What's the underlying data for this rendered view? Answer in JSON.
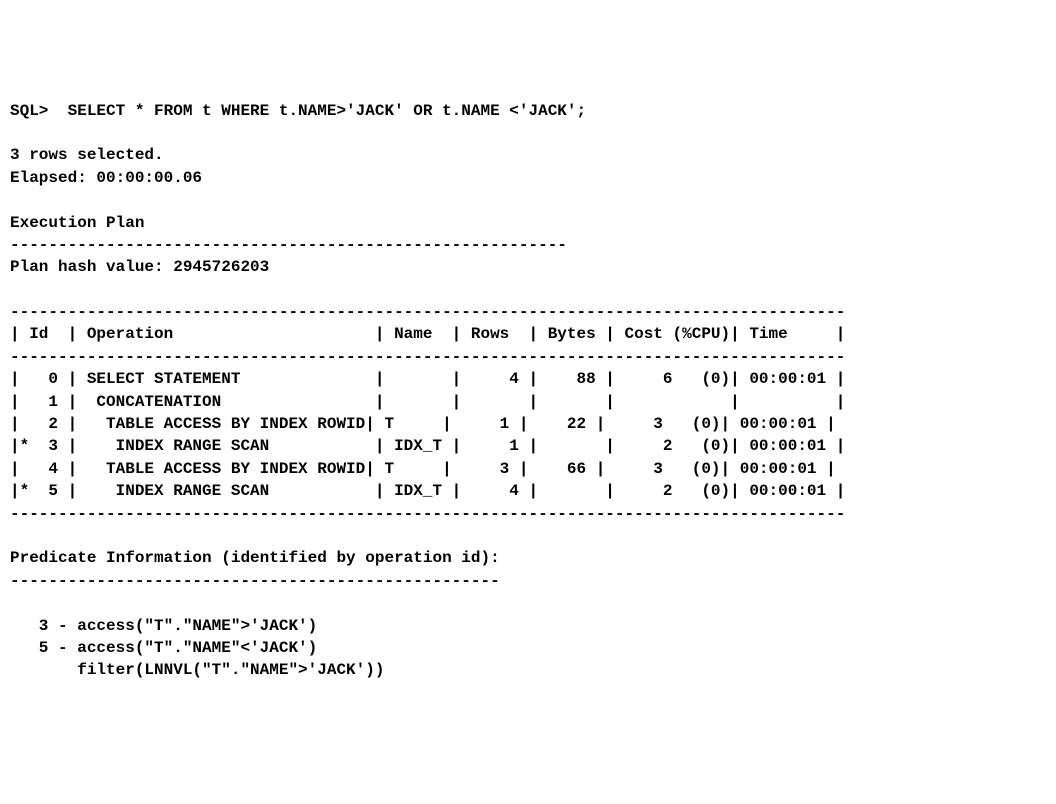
{
  "prompt": "SQL>",
  "query": "SELECT * FROM t WHERE t.NAME>'JACK' OR t.NAME <'JACK';",
  "rows_selected": "3 rows selected.",
  "elapsed": "Elapsed: 00:00:00.06",
  "exec_plan_header": "Execution Plan",
  "dash_line_short": "----------------------------------------------------------",
  "plan_hash": "Plan hash value: 2945726203",
  "dash_line_long": "---------------------------------------------------------------------------------------",
  "table_header": "| Id  | Operation                     | Name  | Rows  | Bytes | Cost (%CPU)| Time     |",
  "plan_rows": [
    "|   0 | SELECT STATEMENT              |       |     4 |    88 |     6   (0)| 00:00:01 |",
    "|   1 |  CONCATENATION                |       |       |       |            |          |",
    "|   2 |   TABLE ACCESS BY INDEX ROWID| T     |     1 |    22 |     3   (0)| 00:00:01 |",
    "|*  3 |    INDEX RANGE SCAN           | IDX_T |     1 |       |     2   (0)| 00:00:01 |",
    "|   4 |   TABLE ACCESS BY INDEX ROWID| T     |     3 |    66 |     3   (0)| 00:00:01 |",
    "|*  5 |    INDEX RANGE SCAN           | IDX_T |     4 |       |     2   (0)| 00:00:01 |"
  ],
  "predicate_header": "Predicate Information (identified by operation id):",
  "dash_line_pred": "---------------------------------------------------",
  "predicates": [
    "   3 - access(\"T\".\"NAME\">'JACK')",
    "   5 - access(\"T\".\"NAME\"<'JACK')",
    "       filter(LNNVL(\"T\".\"NAME\">'JACK'))"
  ]
}
